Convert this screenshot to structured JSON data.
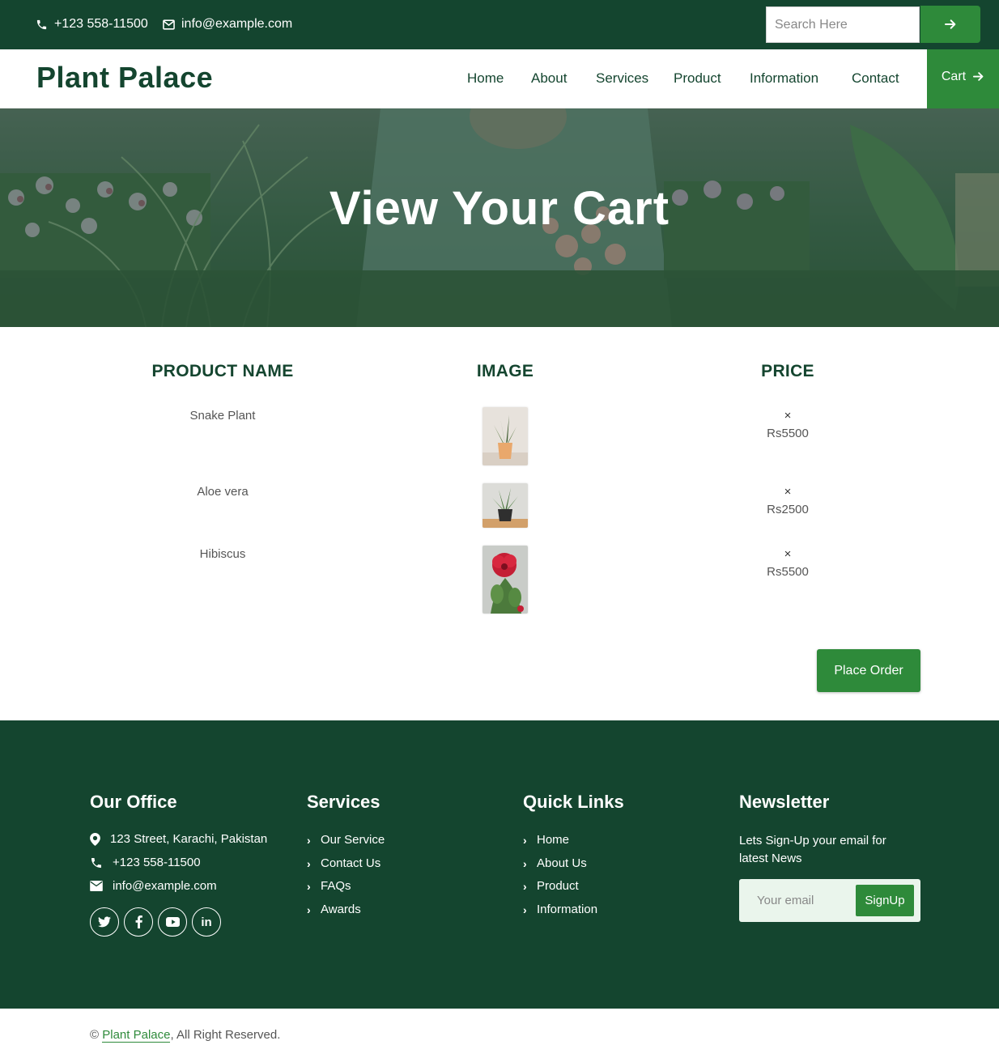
{
  "topbar": {
    "phone": "+123 558-11500",
    "email": "info@example.com",
    "search_placeholder": "Search Here",
    "icons": {
      "phone": "phone-icon",
      "email": "envelope-icon",
      "search_submit": "arrow-right-icon"
    }
  },
  "header": {
    "brand": "Plant Palace",
    "nav": [
      "Home",
      "About",
      "Services",
      "Product",
      "Information",
      "Contact"
    ],
    "cart_label": "Cart"
  },
  "hero": {
    "title": "View Your Cart"
  },
  "cart": {
    "headers": {
      "name": "PRODUCT NAME",
      "image": "IMAGE",
      "price": "PRICE"
    },
    "remove_symbol": "×",
    "items": [
      {
        "name": "Snake Plant",
        "price": "Rs5500",
        "image": "snake-plant-image"
      },
      {
        "name": "Aloe vera",
        "price": "Rs2500",
        "image": "aloe-vera-image"
      },
      {
        "name": "Hibiscus",
        "price": "Rs5500",
        "image": "hibiscus-image"
      }
    ],
    "place_order_label": "Place Order"
  },
  "footer": {
    "office": {
      "title": "Our Office",
      "address": "123 Street, Karachi, Pakistan",
      "phone": "+123 558-11500",
      "email": "info@example.com",
      "socials": [
        "twitter-icon",
        "facebook-icon",
        "youtube-icon",
        "linkedin-icon"
      ]
    },
    "services": {
      "title": "Services",
      "links": [
        "Our Service",
        "Contact Us",
        "FAQs",
        "Awards"
      ]
    },
    "quick_links": {
      "title": "Quick Links",
      "links": [
        "Home",
        "About Us",
        "Product",
        "Information"
      ]
    },
    "newsletter": {
      "title": "Newsletter",
      "text": "Lets Sign-Up your email for latest News",
      "input_placeholder": "Your email",
      "button_label": "SignUp"
    }
  },
  "copyright": {
    "prefix": "©",
    "brand": "Plant Palace",
    "suffix": ", All Right Reserved."
  },
  "colors": {
    "dark_green": "#14452f",
    "accent_green": "#2e8a3a",
    "white": "#ffffff"
  }
}
